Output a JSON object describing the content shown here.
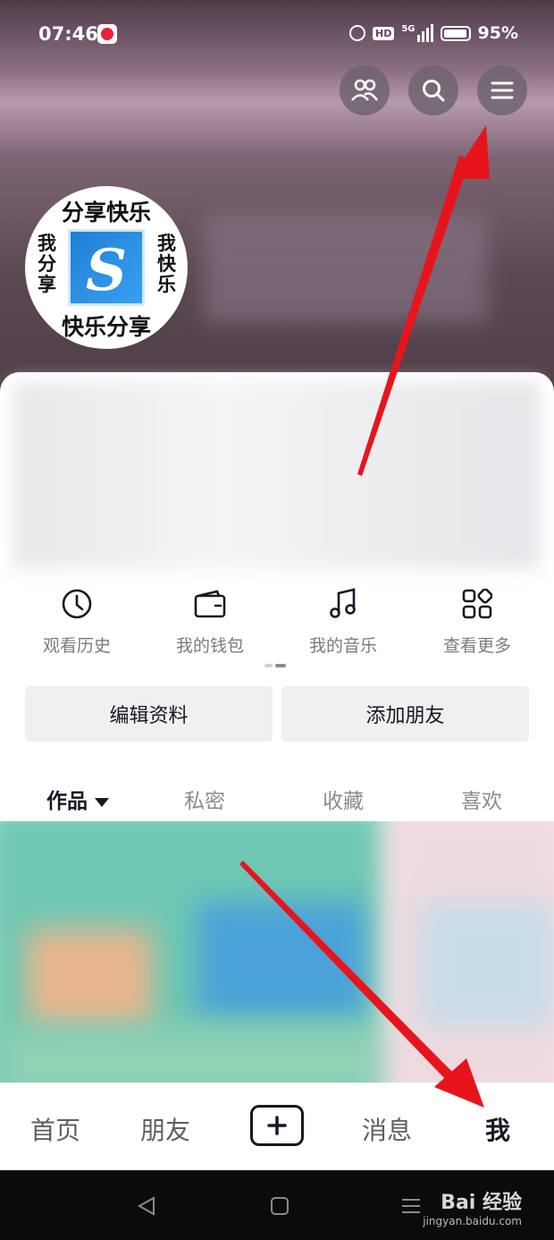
{
  "status_bar": {
    "time": "07:46",
    "hd": "HD",
    "network": "5G",
    "battery": "95%"
  },
  "header": {
    "buttons": [
      {
        "icon": "friends-icon"
      },
      {
        "icon": "search-icon"
      },
      {
        "icon": "menu-icon"
      }
    ]
  },
  "avatar": {
    "top_text": "分享快乐",
    "bottom_text": "快乐分享",
    "left_text": "我分享",
    "right_text": "我快乐",
    "logo_letter": "S"
  },
  "tools": [
    {
      "label": "观看历史",
      "icon": "clock-icon"
    },
    {
      "label": "我的钱包",
      "icon": "wallet-icon"
    },
    {
      "label": "我的音乐",
      "icon": "music-note-icon"
    },
    {
      "label": "查看更多",
      "icon": "grid-more-icon"
    }
  ],
  "actions": {
    "edit_profile": "编辑资料",
    "add_friend": "添加朋友"
  },
  "tabs": [
    {
      "label": "作品",
      "active": true
    },
    {
      "label": "私密",
      "active": false
    },
    {
      "label": "收藏",
      "active": false
    },
    {
      "label": "喜欢",
      "active": false
    }
  ],
  "bottom_nav": {
    "home": "首页",
    "friends": "朋友",
    "create_icon": "plus-icon",
    "messages": "消息",
    "me": "我"
  },
  "watermark": {
    "main": "Bai 经验",
    "sub": "jingyan.baidu.com"
  },
  "colors": {
    "annotation_arrow": "#e8141b",
    "text_primary": "#161823",
    "text_secondary": "#7a7b83"
  }
}
